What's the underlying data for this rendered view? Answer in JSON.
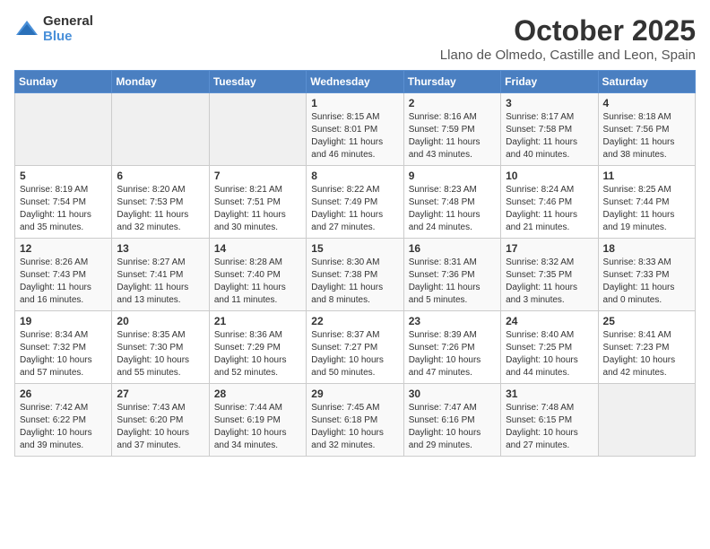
{
  "logo": {
    "general": "General",
    "blue": "Blue"
  },
  "title": "October 2025",
  "location": "Llano de Olmedo, Castille and Leon, Spain",
  "weekdays": [
    "Sunday",
    "Monday",
    "Tuesday",
    "Wednesday",
    "Thursday",
    "Friday",
    "Saturday"
  ],
  "weeks": [
    [
      {
        "day": "",
        "info": ""
      },
      {
        "day": "",
        "info": ""
      },
      {
        "day": "",
        "info": ""
      },
      {
        "day": "1",
        "info": "Sunrise: 8:15 AM\nSunset: 8:01 PM\nDaylight: 11 hours and 46 minutes."
      },
      {
        "day": "2",
        "info": "Sunrise: 8:16 AM\nSunset: 7:59 PM\nDaylight: 11 hours and 43 minutes."
      },
      {
        "day": "3",
        "info": "Sunrise: 8:17 AM\nSunset: 7:58 PM\nDaylight: 11 hours and 40 minutes."
      },
      {
        "day": "4",
        "info": "Sunrise: 8:18 AM\nSunset: 7:56 PM\nDaylight: 11 hours and 38 minutes."
      }
    ],
    [
      {
        "day": "5",
        "info": "Sunrise: 8:19 AM\nSunset: 7:54 PM\nDaylight: 11 hours and 35 minutes."
      },
      {
        "day": "6",
        "info": "Sunrise: 8:20 AM\nSunset: 7:53 PM\nDaylight: 11 hours and 32 minutes."
      },
      {
        "day": "7",
        "info": "Sunrise: 8:21 AM\nSunset: 7:51 PM\nDaylight: 11 hours and 30 minutes."
      },
      {
        "day": "8",
        "info": "Sunrise: 8:22 AM\nSunset: 7:49 PM\nDaylight: 11 hours and 27 minutes."
      },
      {
        "day": "9",
        "info": "Sunrise: 8:23 AM\nSunset: 7:48 PM\nDaylight: 11 hours and 24 minutes."
      },
      {
        "day": "10",
        "info": "Sunrise: 8:24 AM\nSunset: 7:46 PM\nDaylight: 11 hours and 21 minutes."
      },
      {
        "day": "11",
        "info": "Sunrise: 8:25 AM\nSunset: 7:44 PM\nDaylight: 11 hours and 19 minutes."
      }
    ],
    [
      {
        "day": "12",
        "info": "Sunrise: 8:26 AM\nSunset: 7:43 PM\nDaylight: 11 hours and 16 minutes."
      },
      {
        "day": "13",
        "info": "Sunrise: 8:27 AM\nSunset: 7:41 PM\nDaylight: 11 hours and 13 minutes."
      },
      {
        "day": "14",
        "info": "Sunrise: 8:28 AM\nSunset: 7:40 PM\nDaylight: 11 hours and 11 minutes."
      },
      {
        "day": "15",
        "info": "Sunrise: 8:30 AM\nSunset: 7:38 PM\nDaylight: 11 hours and 8 minutes."
      },
      {
        "day": "16",
        "info": "Sunrise: 8:31 AM\nSunset: 7:36 PM\nDaylight: 11 hours and 5 minutes."
      },
      {
        "day": "17",
        "info": "Sunrise: 8:32 AM\nSunset: 7:35 PM\nDaylight: 11 hours and 3 minutes."
      },
      {
        "day": "18",
        "info": "Sunrise: 8:33 AM\nSunset: 7:33 PM\nDaylight: 11 hours and 0 minutes."
      }
    ],
    [
      {
        "day": "19",
        "info": "Sunrise: 8:34 AM\nSunset: 7:32 PM\nDaylight: 10 hours and 57 minutes."
      },
      {
        "day": "20",
        "info": "Sunrise: 8:35 AM\nSunset: 7:30 PM\nDaylight: 10 hours and 55 minutes."
      },
      {
        "day": "21",
        "info": "Sunrise: 8:36 AM\nSunset: 7:29 PM\nDaylight: 10 hours and 52 minutes."
      },
      {
        "day": "22",
        "info": "Sunrise: 8:37 AM\nSunset: 7:27 PM\nDaylight: 10 hours and 50 minutes."
      },
      {
        "day": "23",
        "info": "Sunrise: 8:39 AM\nSunset: 7:26 PM\nDaylight: 10 hours and 47 minutes."
      },
      {
        "day": "24",
        "info": "Sunrise: 8:40 AM\nSunset: 7:25 PM\nDaylight: 10 hours and 44 minutes."
      },
      {
        "day": "25",
        "info": "Sunrise: 8:41 AM\nSunset: 7:23 PM\nDaylight: 10 hours and 42 minutes."
      }
    ],
    [
      {
        "day": "26",
        "info": "Sunrise: 7:42 AM\nSunset: 6:22 PM\nDaylight: 10 hours and 39 minutes."
      },
      {
        "day": "27",
        "info": "Sunrise: 7:43 AM\nSunset: 6:20 PM\nDaylight: 10 hours and 37 minutes."
      },
      {
        "day": "28",
        "info": "Sunrise: 7:44 AM\nSunset: 6:19 PM\nDaylight: 10 hours and 34 minutes."
      },
      {
        "day": "29",
        "info": "Sunrise: 7:45 AM\nSunset: 6:18 PM\nDaylight: 10 hours and 32 minutes."
      },
      {
        "day": "30",
        "info": "Sunrise: 7:47 AM\nSunset: 6:16 PM\nDaylight: 10 hours and 29 minutes."
      },
      {
        "day": "31",
        "info": "Sunrise: 7:48 AM\nSunset: 6:15 PM\nDaylight: 10 hours and 27 minutes."
      },
      {
        "day": "",
        "info": ""
      }
    ]
  ]
}
